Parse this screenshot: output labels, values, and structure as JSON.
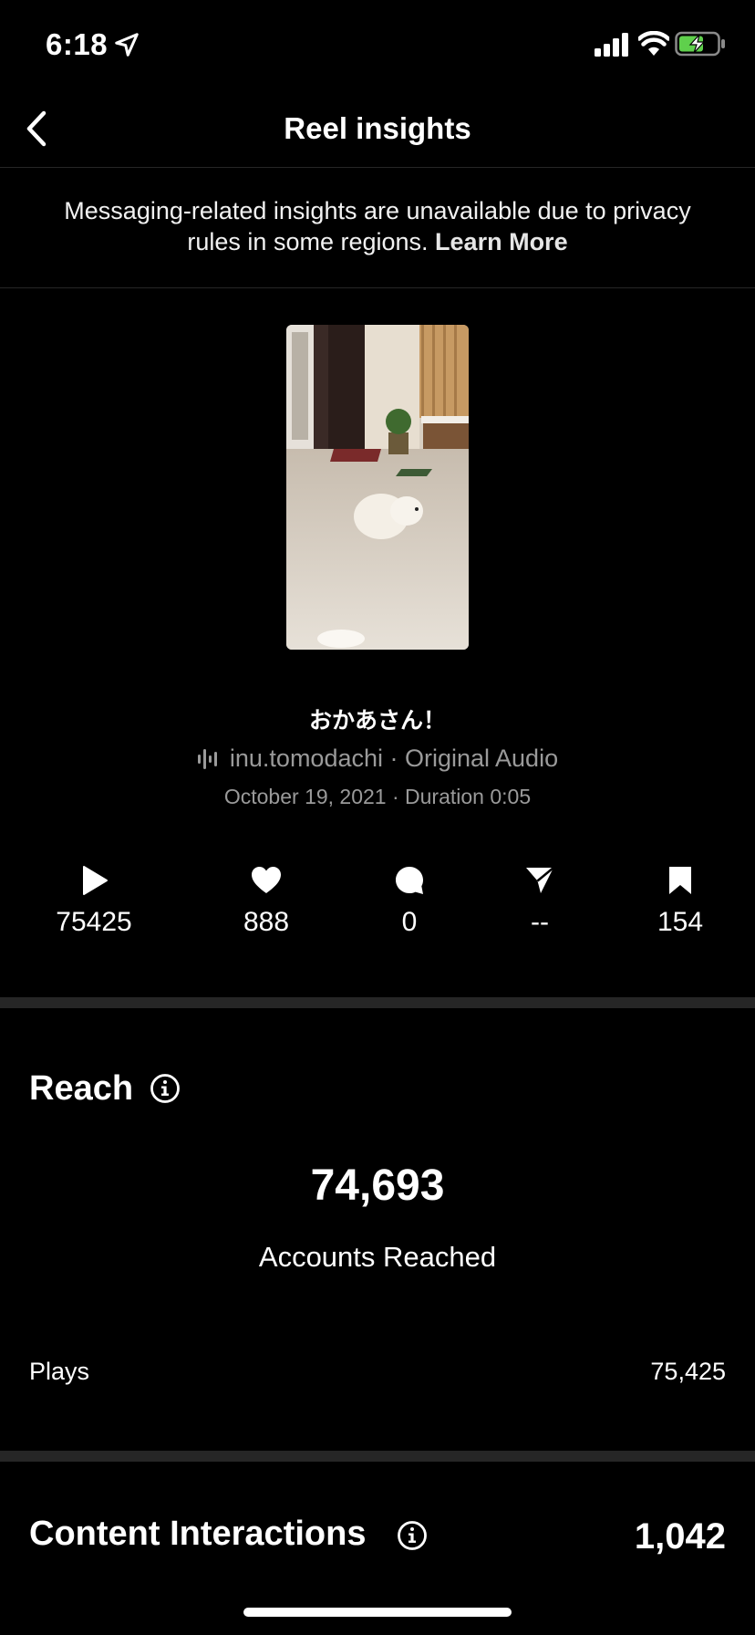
{
  "status_bar": {
    "time": "6:18"
  },
  "nav": {
    "title": "Reel insights"
  },
  "notice": {
    "text": "Messaging-related insights are unavailable due to privacy rules in some regions.",
    "link": "Learn More"
  },
  "reel": {
    "caption": "おかあさん！",
    "audio": "inu.tomodachi · Original Audio",
    "date_duration": "October 19, 2021 · Duration 0:05"
  },
  "stats": {
    "plays": "75425",
    "likes": "888",
    "comments": "0",
    "shares": "--",
    "saves": "154"
  },
  "reach": {
    "title": "Reach",
    "accounts_reached": "74,693",
    "accounts_reached_label": "Accounts Reached",
    "plays_label": "Plays",
    "plays_value": "75,425"
  },
  "content_interactions": {
    "title": "Content Interactions",
    "value": "1,042"
  },
  "icons": {
    "back": "chevron-left-icon",
    "location": "location-arrow-icon",
    "play": "play-icon",
    "like": "heart-icon",
    "comment": "comment-bubble-icon",
    "share": "paper-plane-icon",
    "save": "bookmark-icon",
    "info": "info-icon",
    "audio": "audio-wave-icon"
  }
}
